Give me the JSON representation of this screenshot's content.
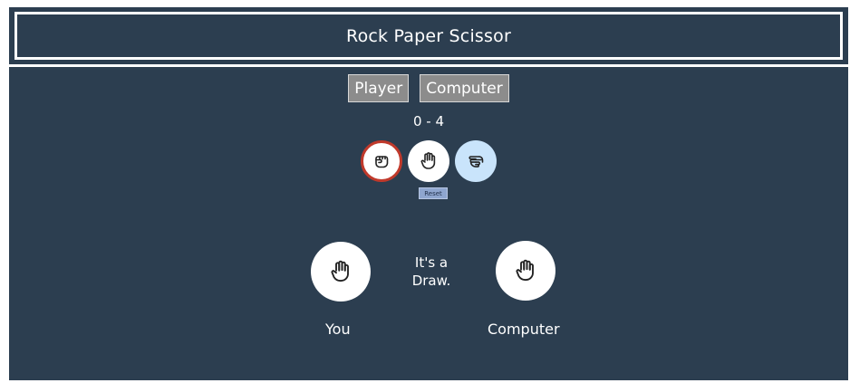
{
  "header": {
    "title": "Rock Paper Scissor"
  },
  "tabs": [
    {
      "label": "Player"
    },
    {
      "label": "Computer"
    }
  ],
  "score": "0 - 4",
  "choices": [
    {
      "name": "rock",
      "icon": "fist-icon",
      "selected": true
    },
    {
      "name": "paper",
      "icon": "open-hand-icon",
      "selected": false
    },
    {
      "name": "scissors",
      "icon": "scissors-hand-icon",
      "selected": false
    }
  ],
  "reset_label": "Reset",
  "result": {
    "line1": "It's a",
    "line2": "Draw."
  },
  "player": {
    "label": "You",
    "icon": "open-hand-icon"
  },
  "computer": {
    "label": "Computer",
    "icon": "open-hand-icon"
  },
  "colors": {
    "background": "#2c3e50",
    "selected_border": "#c0392b",
    "scissors_bg": "#c9e4fb",
    "tab_bg": "#8c8c8c",
    "reset_bg": "#8fa6cf"
  }
}
